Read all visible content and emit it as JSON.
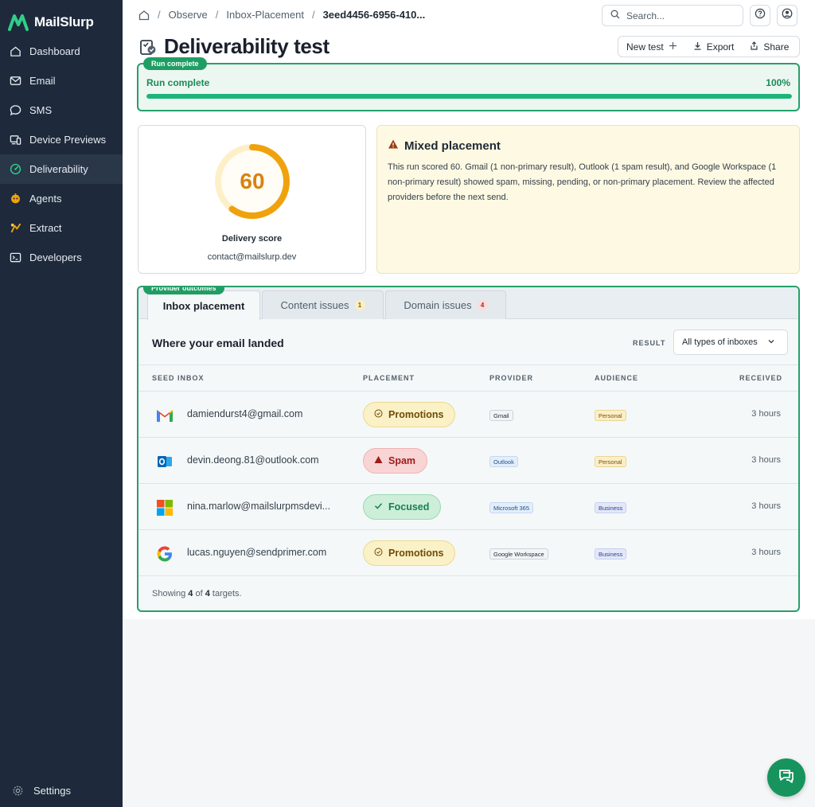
{
  "app": {
    "name": "MailSlurp"
  },
  "sidebar": {
    "items": [
      {
        "label": "Dashboard",
        "icon": "home-icon"
      },
      {
        "label": "Email",
        "icon": "mail-icon"
      },
      {
        "label": "SMS",
        "icon": "message-icon"
      },
      {
        "label": "Device Previews",
        "icon": "devices-icon"
      },
      {
        "label": "Deliverability",
        "icon": "gauge-icon",
        "active": true
      },
      {
        "label": "Agents",
        "icon": "bot-icon"
      },
      {
        "label": "Extract",
        "icon": "extract-icon"
      },
      {
        "label": "Developers",
        "icon": "terminal-icon"
      }
    ],
    "settings_label": "Settings"
  },
  "breadcrumb": {
    "items": [
      "Observe",
      "Inbox-Placement",
      "3eed4456-6956-410..."
    ]
  },
  "search": {
    "placeholder": "Search..."
  },
  "page": {
    "title": "Deliverability test",
    "actions": {
      "new_test": "New test",
      "export": "Export",
      "share": "Share"
    }
  },
  "progress": {
    "pill": "Run complete",
    "label": "Run complete",
    "percent_text": "100%",
    "percent": 100
  },
  "score": {
    "value": "60",
    "fraction": 0.6,
    "label": "Delivery score",
    "email": "contact@mailslurp.dev",
    "color": "#f0a20c"
  },
  "mixed": {
    "title": "Mixed placement",
    "body": "This run scored 60. Gmail (1 non-primary result), Outlook (1 spam result), and Google Workspace (1 non-primary result) showed spam, missing, pending, or non-primary placement. Review the affected providers before the next send."
  },
  "outcomes": {
    "pill": "Provider outcomes",
    "tabs": [
      {
        "label": "Inbox placement",
        "active": true
      },
      {
        "label": "Content issues",
        "badge": "1"
      },
      {
        "label": "Domain issues",
        "badge": "4"
      }
    ],
    "section_title": "Where your email landed",
    "result_label": "RESULT",
    "result_select": "All types of inboxes",
    "columns": [
      "SEED INBOX",
      "PLACEMENT",
      "PROVIDER",
      "AUDIENCE",
      "RECEIVED"
    ],
    "rows": [
      {
        "logo": "gmail-icon",
        "email": "damiendurst4@gmail.com",
        "placement": "Promotions",
        "provider": "Gmail",
        "audience": "Personal",
        "received": "3 hours"
      },
      {
        "logo": "outlook-icon",
        "email": "devin.deong.81@outlook.com",
        "placement": "Spam",
        "provider": "Outlook",
        "audience": "Personal",
        "received": "3 hours"
      },
      {
        "logo": "microsoft-icon",
        "email": "nina.marlow@mailslurpmsdevi...",
        "placement": "Focused",
        "provider": "Microsoft 365",
        "audience": "Business",
        "received": "3 hours"
      },
      {
        "logo": "google-icon",
        "email": "lucas.nguyen@sendprimer.com",
        "placement": "Promotions",
        "provider": "Google Workspace",
        "audience": "Business",
        "received": "3 hours"
      }
    ],
    "footer": {
      "prefix": "Showing",
      "shown": "4",
      "of": "of",
      "total": "4",
      "suffix": "targets."
    }
  },
  "colors": {
    "accent": "#1f9e63",
    "sidebar": "#1e2a3b"
  }
}
